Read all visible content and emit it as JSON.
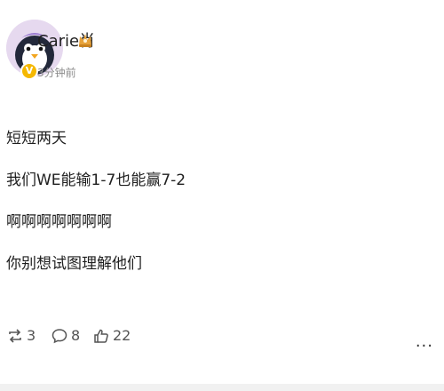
{
  "user": {
    "name": "Carie肖",
    "time": "3分钟前",
    "verified_mark": "V"
  },
  "post": {
    "lines": [
      "短短两天",
      "我们WE能输1-7也能赢7-2",
      "啊啊啊啊啊啊啊",
      "你别想试图理解他们"
    ]
  },
  "actions": {
    "repost_count": "3",
    "comment_count": "8",
    "like_count": "22",
    "more_label": "..."
  },
  "icons": {
    "avatar": "penguin-avatar",
    "crown": "crown-icon",
    "repost": "repost-icon",
    "comment": "comment-icon",
    "like": "thumb-up-icon",
    "more": "more-icon"
  },
  "colors": {
    "badge": "#f5b800",
    "crown": "#e7a23a",
    "text": "#1f1f1f",
    "muted": "#8c8c8c"
  }
}
